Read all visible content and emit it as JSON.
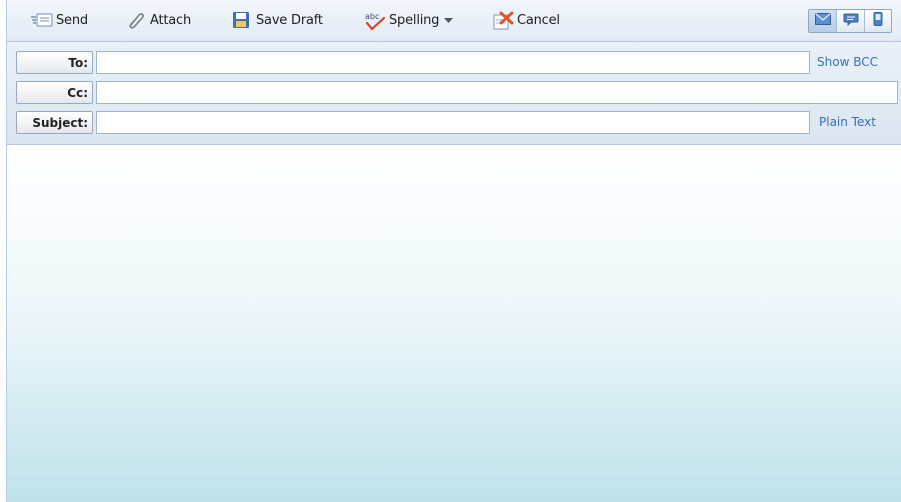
{
  "toolbar": {
    "send": {
      "label": "Send",
      "icon": "send-icon"
    },
    "attach": {
      "label": "Attach",
      "icon": "paperclip-icon"
    },
    "save_draft": {
      "label": "Save Draft",
      "icon": "floppy-disk-icon"
    },
    "spelling": {
      "label": "Spelling",
      "icon": "spellcheck-icon"
    },
    "cancel": {
      "label": "Cancel",
      "icon": "cancel-icon"
    },
    "views": [
      {
        "icon": "envelope-icon",
        "active": true
      },
      {
        "icon": "chat-icon",
        "active": false
      },
      {
        "icon": "mobile-phone-icon",
        "active": false
      }
    ]
  },
  "headers": {
    "to": {
      "label": "To:",
      "value": ""
    },
    "cc": {
      "label": "Cc:",
      "value": ""
    },
    "subject": {
      "label": "Subject:",
      "value": ""
    },
    "show_bcc": "Show BCC",
    "plain_text": "Plain Text"
  },
  "body": {
    "value": ""
  },
  "colors": {
    "link": "#3a6fb0",
    "toolbar_top": "#f3f7fb",
    "body_bottom": "#bfe2ea"
  }
}
